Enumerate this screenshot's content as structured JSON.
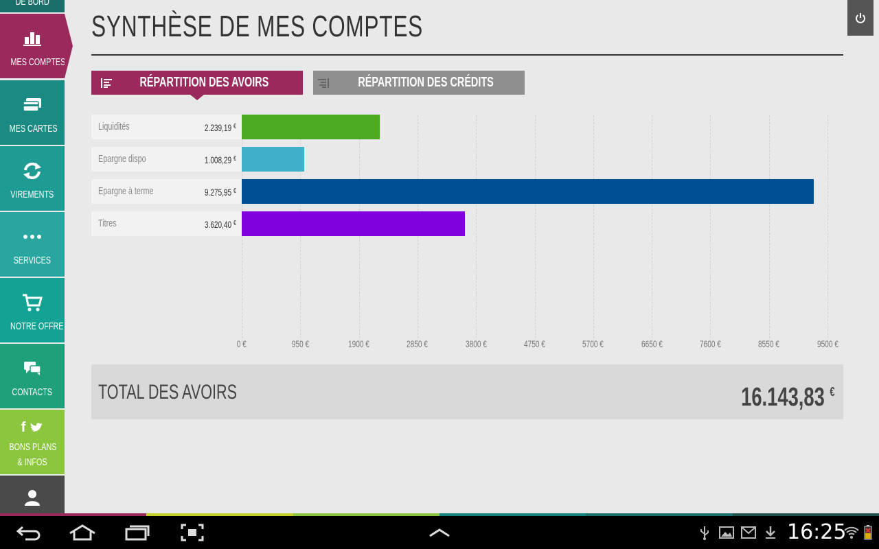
{
  "sidebar": {
    "items": [
      {
        "label": "DE BORD",
        "label2": "",
        "icon": "dashboard-icon",
        "color": "#1a6f6a"
      },
      {
        "label": "MES COMPTES",
        "label2": "",
        "icon": "bar-chart-icon",
        "color": "#9b2a5c"
      },
      {
        "label": "MES CARTES",
        "label2": "",
        "icon": "cards-icon",
        "color": "#1b8a82"
      },
      {
        "label": "VIREMENTS",
        "label2": "",
        "icon": "transfer-icon",
        "color": "#1e9b92"
      },
      {
        "label": "SERVICES",
        "label2": "",
        "icon": "dots-icon",
        "color": "#2aa6a0"
      },
      {
        "label": "NOTRE OFFRE",
        "label2": "",
        "icon": "cart-icon",
        "color": "#13a394"
      },
      {
        "label": "CONTACTS",
        "label2": "",
        "icon": "chat-icon",
        "color": "#1fa07a"
      },
      {
        "label": "BONS PLANS",
        "label2": "& INFOS",
        "icon": "facebook-twitter-icon",
        "color": "#8cc63f"
      },
      {
        "label": "",
        "label2": "",
        "icon": "user-icon",
        "color": "#4a4a4a"
      }
    ]
  },
  "header": {
    "title": "SYNTHÈSE DE MES COMPTES",
    "power_icon": "power-icon"
  },
  "tabs": [
    {
      "label": "RÉPARTITION DES AVOIRS",
      "icon": "list-left-icon",
      "active": true
    },
    {
      "label": "RÉPARTITION DES CRÉDITS",
      "icon": "list-right-icon",
      "active": false
    }
  ],
  "chart_data": {
    "type": "bar",
    "orientation": "horizontal",
    "categories": [
      "Liquidités",
      "Epargne dispo",
      "Epargne à terme",
      "Titres"
    ],
    "values": [
      2239.19,
      1008.29,
      9275.95,
      3620.4
    ],
    "value_labels": [
      "2.239,19",
      "1.008,29",
      "9.275,95",
      "3.620,40"
    ],
    "currency": "€",
    "colors": [
      "#4caa22",
      "#3eb1c8",
      "#004f94",
      "#8000e0"
    ],
    "xlim": [
      0,
      9500
    ],
    "ticks": [
      0,
      950,
      1900,
      2850,
      3800,
      4750,
      5700,
      6650,
      7600,
      8550,
      9500
    ],
    "tick_labels": [
      "0 €",
      "950 €",
      "1900 €",
      "2850 €",
      "3800 €",
      "4750 €",
      "5700 €",
      "6650 €",
      "7600 €",
      "8550 €",
      "9500 €"
    ],
    "grid": true,
    "title": "",
    "xlabel": "",
    "ylabel": ""
  },
  "total": {
    "label": "TOTAL DES AVOIRS",
    "value": "16.143,83",
    "currency": "€"
  },
  "colors": {
    "accent": "#9b2a5c",
    "inactive_tab": "#8f8f8f",
    "strip": [
      "#9b2a5c",
      "#c5d12b",
      "#8cc63f",
      "#15837e",
      "#1a6f6a",
      "#20504c"
    ]
  },
  "system_bar": {
    "time": "16:25",
    "nav_icons": [
      "back-icon",
      "home-icon",
      "recent-apps-icon",
      "screenshot-icon",
      "up-chevron-icon"
    ],
    "status_icons": [
      "usb-icon",
      "gallery-icon",
      "gmail-icon",
      "download-icon",
      "wifi-icon",
      "battery-icon"
    ]
  }
}
